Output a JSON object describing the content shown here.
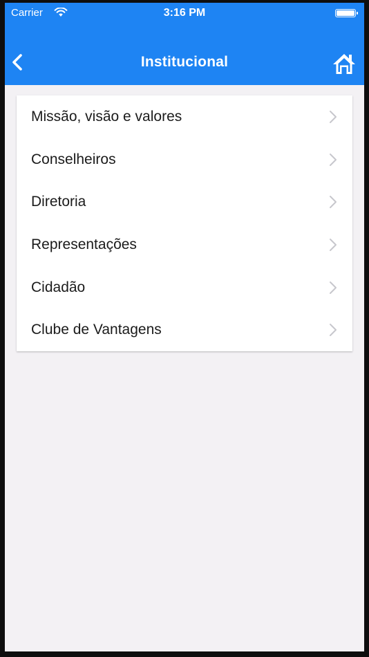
{
  "status_bar": {
    "carrier": "Carrier",
    "time": "3:16 PM",
    "wifi_icon": "wifi-icon",
    "battery_icon": "battery-icon"
  },
  "nav_bar": {
    "title": "Institucional",
    "back_icon": "chevron-left-icon",
    "home_icon": "home-icon"
  },
  "menu": {
    "items": [
      {
        "label": "Missão, visão e valores"
      },
      {
        "label": "Conselheiros"
      },
      {
        "label": "Diretoria"
      },
      {
        "label": "Representações"
      },
      {
        "label": "Cidadão"
      },
      {
        "label": "Clube de Vantagens"
      }
    ],
    "item_icon": "chevron-right-icon"
  },
  "colors": {
    "nav_background": "#1e84f3",
    "page_background": "#f3f1f4",
    "text": "#1b1b1b",
    "chevron": "#c7c7cc"
  }
}
